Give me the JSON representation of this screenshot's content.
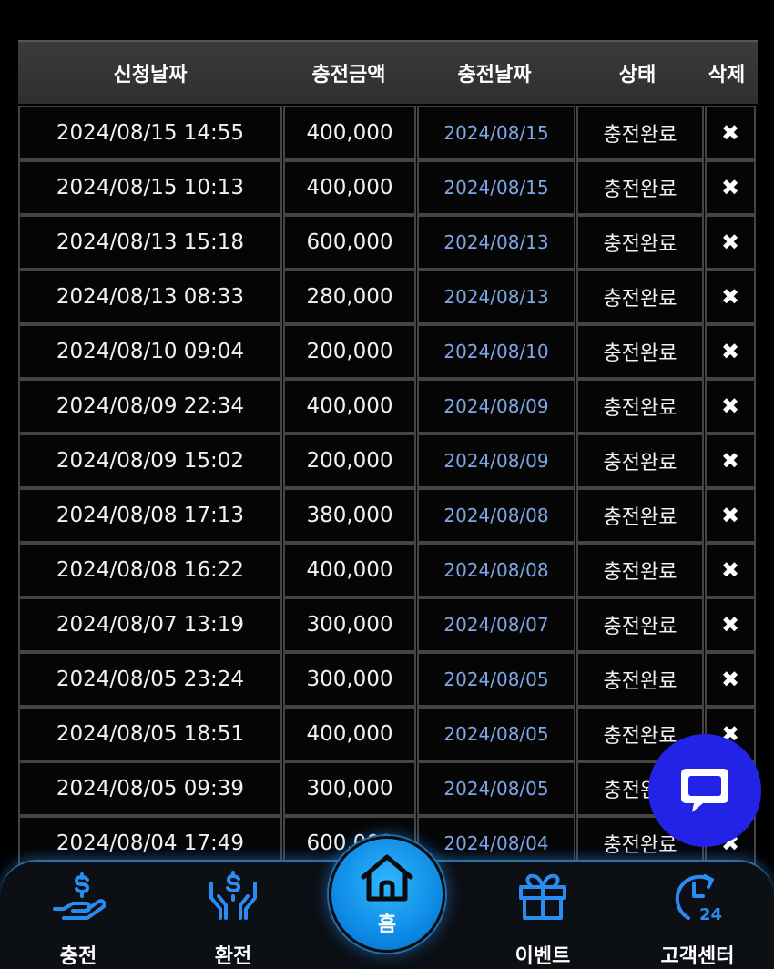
{
  "table": {
    "headers": [
      "신청날짜",
      "충전금액",
      "충전날짜",
      "상태",
      "삭제"
    ],
    "rows": [
      {
        "requested": "2024/08/15 14:55",
        "amount": "400,000",
        "charged": "2024/08/15",
        "status": "충전완료",
        "delete": "✖"
      },
      {
        "requested": "2024/08/15 10:13",
        "amount": "400,000",
        "charged": "2024/08/15",
        "status": "충전완료",
        "delete": "✖"
      },
      {
        "requested": "2024/08/13 15:18",
        "amount": "600,000",
        "charged": "2024/08/13",
        "status": "충전완료",
        "delete": "✖"
      },
      {
        "requested": "2024/08/13 08:33",
        "amount": "280,000",
        "charged": "2024/08/13",
        "status": "충전완료",
        "delete": "✖"
      },
      {
        "requested": "2024/08/10 09:04",
        "amount": "200,000",
        "charged": "2024/08/10",
        "status": "충전완료",
        "delete": "✖"
      },
      {
        "requested": "2024/08/09 22:34",
        "amount": "400,000",
        "charged": "2024/08/09",
        "status": "충전완료",
        "delete": "✖"
      },
      {
        "requested": "2024/08/09 15:02",
        "amount": "200,000",
        "charged": "2024/08/09",
        "status": "충전완료",
        "delete": "✖"
      },
      {
        "requested": "2024/08/08 17:13",
        "amount": "380,000",
        "charged": "2024/08/08",
        "status": "충전완료",
        "delete": "✖"
      },
      {
        "requested": "2024/08/08 16:22",
        "amount": "400,000",
        "charged": "2024/08/08",
        "status": "충전완료",
        "delete": "✖"
      },
      {
        "requested": "2024/08/07 13:19",
        "amount": "300,000",
        "charged": "2024/08/07",
        "status": "충전완료",
        "delete": "✖"
      },
      {
        "requested": "2024/08/05 23:24",
        "amount": "300,000",
        "charged": "2024/08/05",
        "status": "충전완료",
        "delete": "✖"
      },
      {
        "requested": "2024/08/05 18:51",
        "amount": "400,000",
        "charged": "2024/08/05",
        "status": "충전완료",
        "delete": "✖"
      },
      {
        "requested": "2024/08/05 09:39",
        "amount": "300,000",
        "charged": "2024/08/05",
        "status": "충전완료",
        "delete": "✖"
      },
      {
        "requested": "2024/08/04 17:49",
        "amount": "600,000",
        "charged": "2024/08/04",
        "status": "충전완료",
        "delete": "✖"
      }
    ]
  },
  "nav": {
    "charge": "충전",
    "exchange": "환전",
    "home": "홈",
    "event": "이벤트",
    "support": "고객센터"
  },
  "icons": {
    "charge": "hand-coin-icon",
    "exchange": "hands-dollar-icon",
    "home": "home-icon",
    "event": "gift-icon",
    "support": "clock-24-icon",
    "chat": "chat-bubble-icon"
  },
  "colors": {
    "accent": "#0a84e0",
    "date_link": "#7fa6e6",
    "chat_fab": "#2323e8",
    "icon_blue": "#2a8cf0"
  }
}
